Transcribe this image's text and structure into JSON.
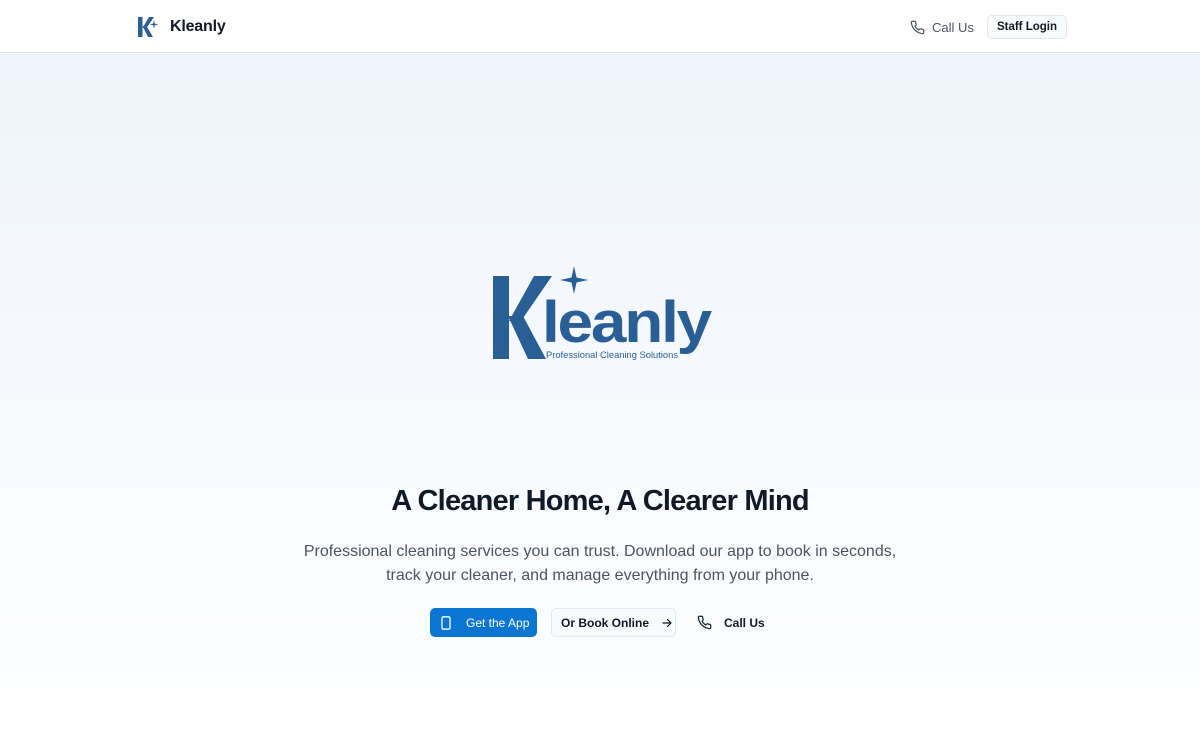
{
  "navbar": {
    "brand_name": "Kleanly",
    "call_label": "Call Us",
    "staff_login_label": "Staff Login"
  },
  "hero": {
    "logo_wordmark": "Kleanly",
    "logo_tagline": "Professional Cleaning Solutions",
    "title": "A Cleaner Home, A Clearer Mind",
    "subtitle": "Professional cleaning services you can trust. Download our app to book in seconds, track your cleaner, and manage everything from your phone.",
    "buttons": {
      "get_app": "Get the App",
      "book_online": "Or Book Online",
      "call": "Call Us"
    }
  },
  "icons": {
    "brand": "kleanly-k-sparkle-logo",
    "phone": "phone-icon",
    "smartphone": "smartphone-icon",
    "arrow": "arrow-right-icon"
  },
  "colors": {
    "brand_blue": "#2a5f96",
    "primary_button": "#0b76d1",
    "text_dark": "#111827",
    "text_muted": "#4b5563",
    "hero_bg_top": "#eef4fb"
  }
}
